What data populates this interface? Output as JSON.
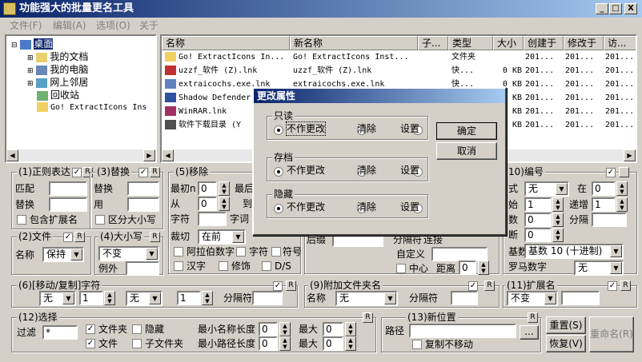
{
  "window": {
    "title": "功能强大的批量更名工具",
    "min": "_",
    "max": "□",
    "close": "X"
  },
  "menu": {
    "file": "文件(F)",
    "edit": "编辑(A)",
    "options": "选项(O)",
    "about": "关于"
  },
  "tree": {
    "items": [
      {
        "label": "桌面",
        "icon": "desktop-icon"
      },
      {
        "label": "我的文档",
        "icon": "documents-icon"
      },
      {
        "label": "我的电脑",
        "icon": "computer-icon"
      },
      {
        "label": "网上邻居",
        "icon": "network-icon"
      },
      {
        "label": "回收站",
        "icon": "recycle-bin-icon"
      },
      {
        "label": "Go! ExtractIcons Ins",
        "icon": "folder-icon"
      }
    ]
  },
  "files": {
    "columns": [
      "名称",
      "新名称",
      "子...",
      "类型",
      "大小",
      "创建于",
      "修改于",
      "访..."
    ],
    "rows": [
      {
        "name": "Go! ExtractIcons In...",
        "newname": "Go! ExtractIcons Inst...",
        "type": "文件夹",
        "size": "",
        "created": "201...",
        "modified": "201...",
        "accessed": "201..."
      },
      {
        "name": "uzzf_软件 (Z).lnk",
        "newname": "uzzf_软件 (Z).lnk",
        "type": "快...",
        "size": "0 KB",
        "created": "201...",
        "modified": "201...",
        "accessed": "201..."
      },
      {
        "name": "extraicochs.exe.lnk",
        "newname": "extraicochs.exe.lnk",
        "type": "快...",
        "size": "0 KB",
        "created": "201...",
        "modified": "201...",
        "accessed": "201..."
      },
      {
        "name": "Shadow Defender",
        "newname": "",
        "type": "",
        "size": "0 KB",
        "created": "201...",
        "modified": "201...",
        "accessed": "201..."
      },
      {
        "name": "WinRAR.lnk",
        "newname": "",
        "type": "",
        "size": "0 KB",
        "created": "201...",
        "modified": "201...",
        "accessed": "201..."
      },
      {
        "name": "软件下载目录 (Y",
        "newname": "",
        "type": "",
        "size": "0 KB",
        "created": "201...",
        "modified": "201...",
        "accessed": "201..."
      }
    ]
  },
  "g1": {
    "title": "(1)正则表达",
    "match": "匹配",
    "replace": "替换",
    "include_ext": "包含扩展名",
    "r": "R"
  },
  "g3": {
    "title": "(3)替换",
    "replace": "替换",
    "with": "用",
    "case": "区分大小写",
    "r": "R"
  },
  "g5": {
    "title": "(5)移除",
    "first_n": "最初n",
    "first_n_val": "0",
    "last": "最后",
    "from": "从",
    "from_val": "0",
    "to": "到",
    "chars": "字符",
    "words": "字词",
    "crop": "裁切",
    "crop_val": "在前",
    "arabic": "阿拉伯数字",
    "char": "字符",
    "symbol": "符号",
    "han": "汉字",
    "trim": "修饰",
    "ds": "D/S"
  },
  "g10": {
    "title": "10)编号",
    "mode": "式",
    "mode_val": "无",
    "at": "在",
    "at_val": "0",
    "start": "始",
    "start_val": "1",
    "step": "递增",
    "step_val": "1",
    "pad": "数",
    "pad_val": "0",
    "sep": "分隔",
    "break": "断",
    "break_val": "0",
    "base_label": "基数",
    "base_val": "基数 10 (十进制)",
    "roman": "罗马数字",
    "roman_val": "无"
  },
  "g2": {
    "title": "(2)文件",
    "name": "名称",
    "name_val": "保持",
    "r": "R"
  },
  "g4": {
    "title": "(4)大小写",
    "case_val": "不变",
    "except": "例外",
    "r": "R"
  },
  "g7": {
    "suffix": "后缀",
    "separator": "分隔符",
    "sep_label": "连接",
    "custom": "自定义",
    "center": "中心",
    "distance": "距离",
    "distance_val": "0"
  },
  "g6": {
    "title": "(6)[移动/复制]字符",
    "a": "无",
    "b": "1",
    "c": "无",
    "d": "1",
    "sep": "分隔符",
    "r": "R"
  },
  "g9": {
    "title": "(9)附加文件夹名",
    "name": "名称",
    "name_val": "无",
    "sep": "分隔符",
    "r": "R"
  },
  "g11": {
    "title": "(11)扩展名",
    "val": "不变",
    "r": "R"
  },
  "g12": {
    "title": "(12)选择",
    "filter": "过滤",
    "filter_val": "*",
    "folders": "文件夹",
    "hidden": "隐藏",
    "files": "文件",
    "subfolders": "子文件夹",
    "min_name": "最小名称长度",
    "min_name_val": "0",
    "max1": "最大",
    "max1_val": "0",
    "min_path": "最小路径长度",
    "min_path_val": "0",
    "max2": "最大",
    "max2_val": "0",
    "r": "R"
  },
  "g13": {
    "title": "(13)新位置",
    "path": "路径",
    "browse": "...",
    "copy": "复制不移动",
    "r": "R"
  },
  "actions": {
    "reset": "重置(S)",
    "restore": "恢复(V)",
    "rename": "重命名(R)"
  },
  "dialog": {
    "title": "更改属性",
    "readonly": "只读",
    "archive": "存档",
    "hidden": "隐藏",
    "no_change": "不作更改",
    "clear": "清除",
    "set": "设置",
    "ok": "确定",
    "cancel": "取消"
  }
}
